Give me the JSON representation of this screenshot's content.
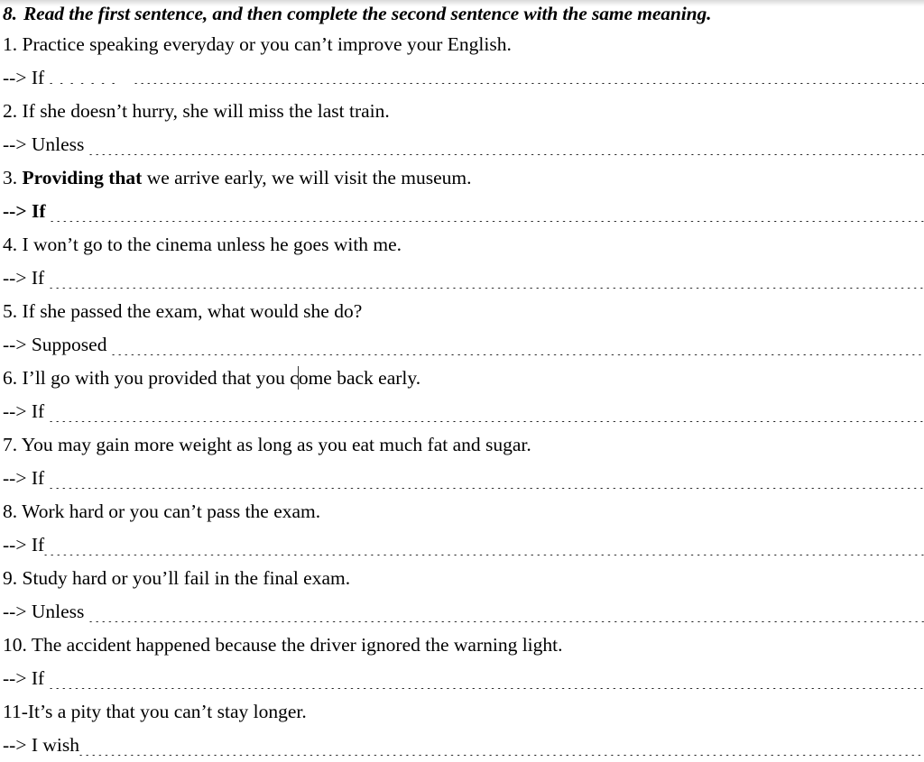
{
  "document": {
    "type": "scanned-worksheet",
    "background_color": "#ffffff",
    "text_color": "#000000",
    "exercise": {
      "number": "8.",
      "instruction": "Read the first sentence, and then complete the second sentence with the same meaning."
    },
    "items": [
      {
        "number": "1.",
        "prompt_before": "Practice speaking everyday or  you can’t improve your English.",
        "prompt_bold": "",
        "prompt_after": "",
        "arrow": "-->",
        "stem": "If",
        "stem_bold": false,
        "leader_style": "gapped"
      },
      {
        "number": "2.",
        "prompt_before": "If she doesn’t hurry, she will miss the last train.",
        "prompt_bold": "",
        "prompt_after": "",
        "arrow": "-->",
        "stem": "Unless",
        "stem_bold": false,
        "leader_style": "normal"
      },
      {
        "number": "3.",
        "prompt_before": "",
        "prompt_bold": "Providing that",
        "prompt_after": " we arrive early, we will visit the museum.",
        "arrow": "-->",
        "stem": "If",
        "stem_bold": true,
        "leader_style": "normal"
      },
      {
        "number": "4.",
        "prompt_before": "I won’t go to the cinema unless he goes with me.",
        "prompt_bold": "",
        "prompt_after": "",
        "arrow": "-->",
        "stem": "If",
        "stem_bold": false,
        "leader_style": "normal"
      },
      {
        "number": "5.",
        "prompt_before": "If she passed the exam, what would she do?",
        "prompt_bold": "",
        "prompt_after": "",
        "arrow": "-->",
        "stem": "Supposed",
        "stem_bold": false,
        "leader_style": "normal"
      },
      {
        "number": "6.",
        "prompt_before": "I’ll  go with you provided that you c",
        "prompt_bold": "",
        "prompt_after": "ome back early.",
        "has_caret": true,
        "arrow": "-->",
        "stem": "If",
        "stem_bold": false,
        "leader_style": "normal"
      },
      {
        "number": "7.",
        "prompt_before": "You may gain more weight as long as you eat much fat and sugar.",
        "prompt_bold": "",
        "prompt_after": "",
        "arrow": "-->",
        "stem": "If",
        "stem_bold": false,
        "leader_style": "normal"
      },
      {
        "number": "8.",
        "prompt_before": "Work hard or you can’t pass the exam.",
        "prompt_bold": "",
        "prompt_after": "",
        "arrow": "-->",
        "stem": "If",
        "stem_bold": false,
        "leader_style": "tight"
      },
      {
        "number": "9.",
        "prompt_before": "Study hard or you’ll fail in the final exam.",
        "prompt_bold": "",
        "prompt_after": "",
        "arrow": "-->",
        "stem": "Unless",
        "stem_bold": false,
        "leader_style": "normal"
      },
      {
        "number": "10.",
        "prompt_before": "The accident happened because the driver ignored the warning light.",
        "prompt_bold": "",
        "prompt_after": "",
        "arrow": "-->",
        "stem": "If",
        "stem_bold": false,
        "leader_style": "normal"
      },
      {
        "number": "11-",
        "prompt_before": "It’s a pity that you can’t stay longer.",
        "prompt_bold": "",
        "prompt_after": "",
        "arrow": "-->",
        "stem": "I wish",
        "stem_bold": false,
        "leader_style": "tight"
      }
    ]
  }
}
